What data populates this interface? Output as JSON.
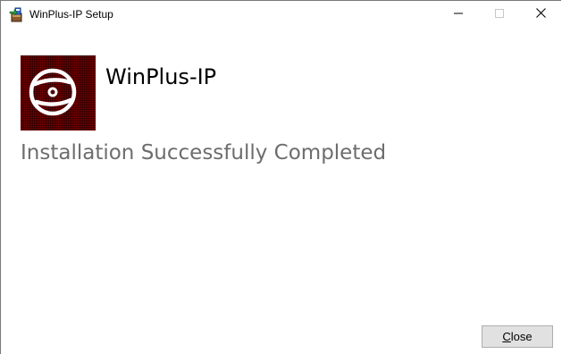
{
  "window": {
    "title": "WinPlus-IP Setup",
    "controls": {
      "minimize_glyph": "—",
      "maximize_glyph": "☐",
      "close_glyph": "✕"
    }
  },
  "header": {
    "product_name": "WinPlus-IP",
    "logo_icon": "disc-icon"
  },
  "content": {
    "status_message": "Installation Successfully Completed"
  },
  "footer": {
    "close_button": {
      "mnemonic": "C",
      "rest": "lose"
    }
  },
  "colors": {
    "status_text": "#6d6d6d",
    "logo_background": "#1a0000",
    "button_face": "#e1e1e1"
  }
}
